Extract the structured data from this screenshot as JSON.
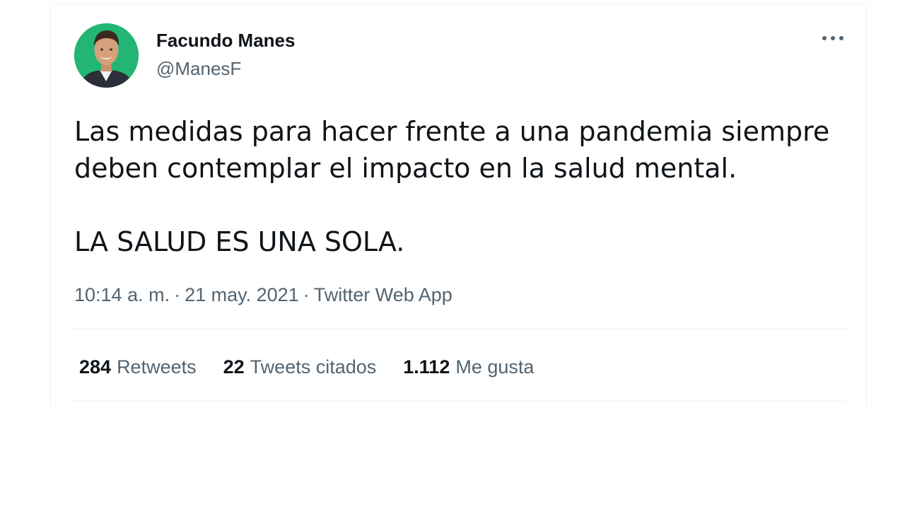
{
  "author": {
    "name": "Facundo Manes",
    "handle": "@ManesF"
  },
  "more_icon": "more-dots-icon",
  "tweet": {
    "line1": "Las medidas para hacer frente a una pandemia siempre deben contemplar el impacto en la salud mental.",
    "line2": "LA SALUD ES UNA SOLA."
  },
  "meta": {
    "time": "10:14 a. m.",
    "separator": "·",
    "date": "21 may. 2021",
    "source": "Twitter Web App"
  },
  "stats": {
    "retweets": {
      "count": "284",
      "label": "Retweets"
    },
    "quotes": {
      "count": "22",
      "label": "Tweets citados"
    },
    "likes": {
      "count": "1.112",
      "label": "Me gusta"
    }
  },
  "colors": {
    "avatar_background": "#22b573",
    "secondary_text": "#536471",
    "primary_text": "#0f1419"
  }
}
